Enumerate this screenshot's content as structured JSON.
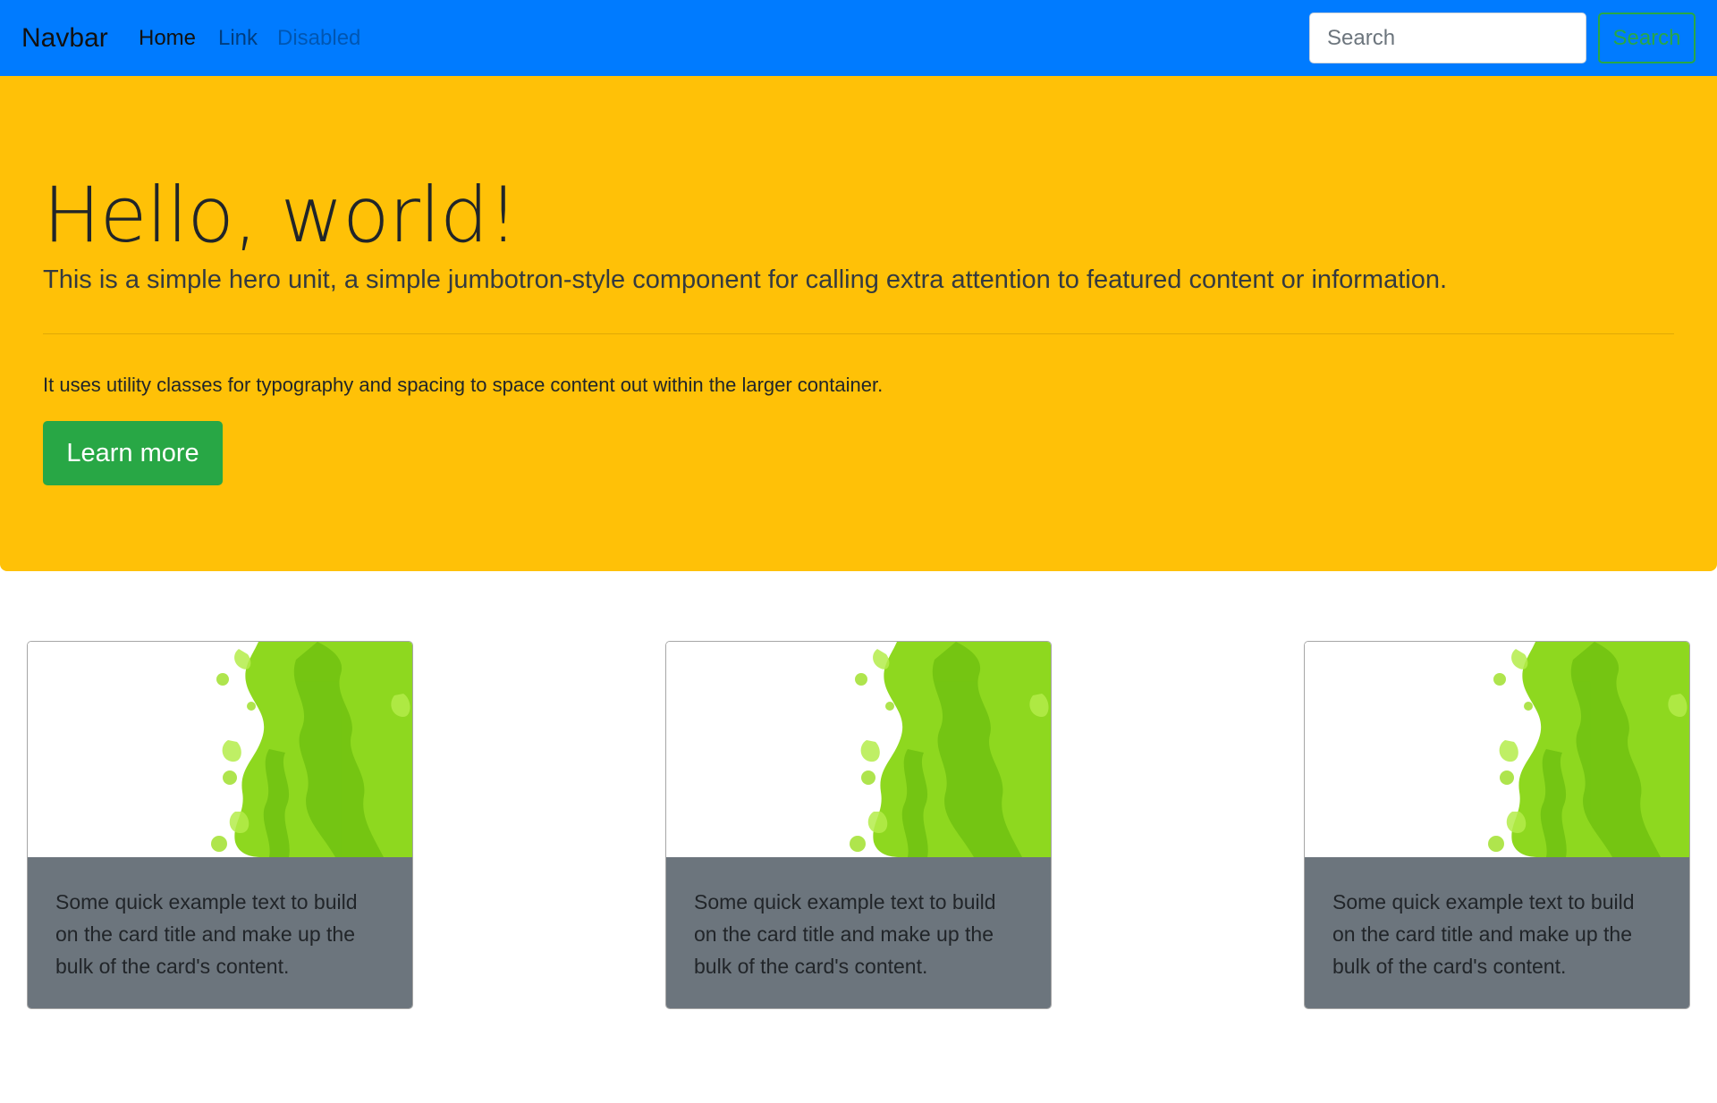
{
  "navbar": {
    "brand": "Navbar",
    "links": [
      {
        "label": "Home"
      },
      {
        "label": "Link"
      },
      {
        "label": "Disabled"
      }
    ],
    "search": {
      "placeholder": "Search",
      "button_label": "Search"
    }
  },
  "hero": {
    "title": "Hello, world!",
    "lead": "This is a simple hero unit, a simple jumbotron-style component for calling extra attention to featured content or information.",
    "text": "It uses utility classes for typography and spacing to space content out within the larger container.",
    "button_label": "Learn more"
  },
  "cards": [
    {
      "text": "Some quick example text to build on the card title and make up the bulk of the card's content."
    },
    {
      "text": "Some quick example text to build on the card title and make up the bulk of the card's content."
    },
    {
      "text": "Some quick example text to build on the card title and make up the bulk of the card's content."
    }
  ],
  "colors": {
    "navbar_bg": "#007bff",
    "jumbotron_bg": "#ffc107",
    "success": "#28a745",
    "card_body_bg": "#6c757d",
    "ink_green": "#8ed81f"
  }
}
